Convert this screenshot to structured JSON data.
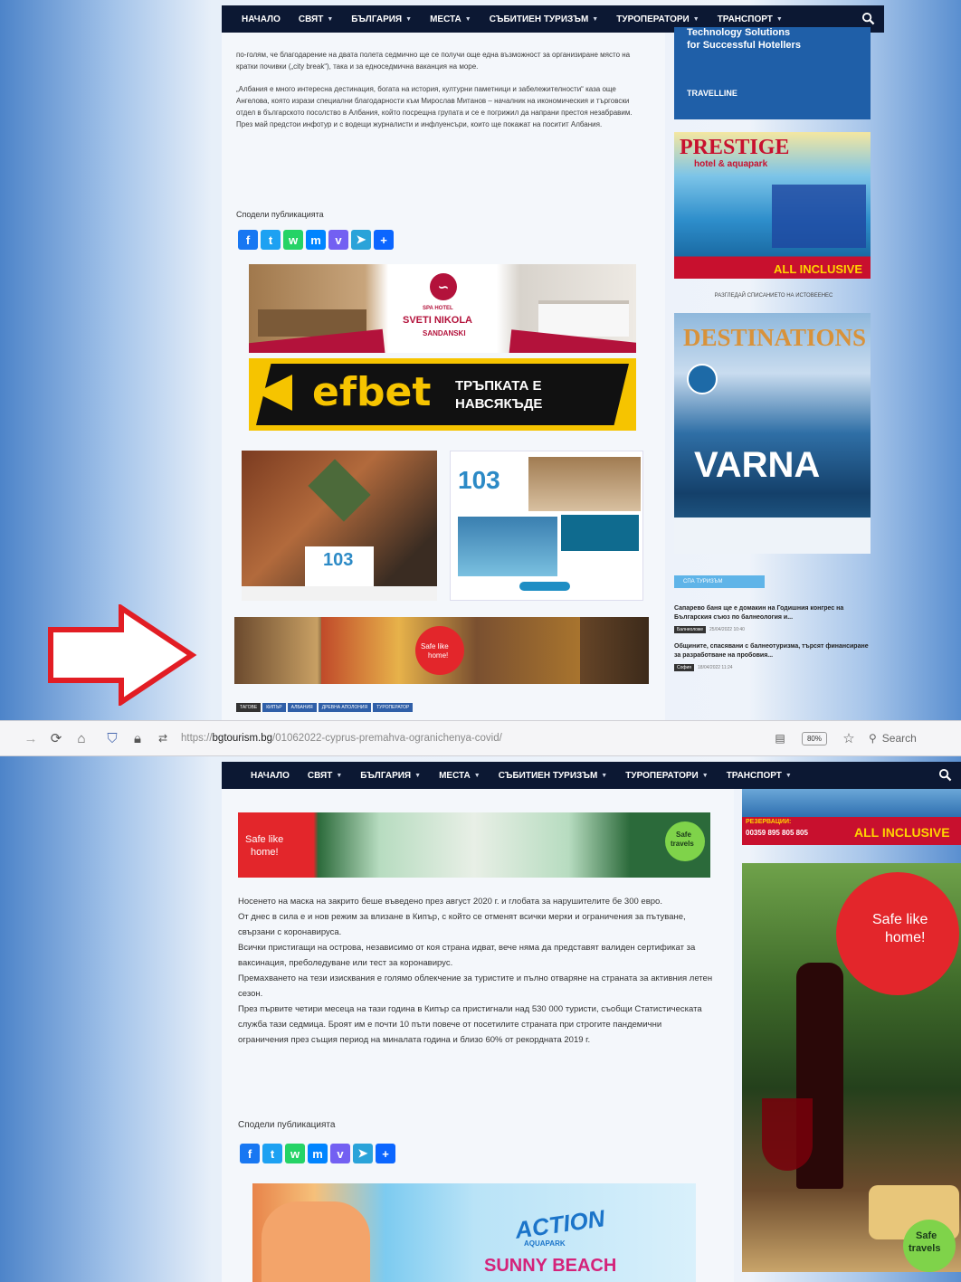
{
  "nav": {
    "items": [
      {
        "label": "НАЧАЛО",
        "dropdown": false
      },
      {
        "label": "СВЯТ",
        "dropdown": true
      },
      {
        "label": "БЪЛГАРИЯ",
        "dropdown": true
      },
      {
        "label": "МЕСТА",
        "dropdown": true
      },
      {
        "label": "СЪБИТИЕН ТУРИЗЪМ",
        "dropdown": true
      },
      {
        "label": "ТУРОПЕРАТОРИ",
        "dropdown": true
      },
      {
        "label": "ТРАНСПОРТ",
        "dropdown": true
      }
    ],
    "search_icon": "search-icon"
  },
  "top": {
    "paragraphs": [
      "по-голям, че благодарение на двата полета седмично ще се получи още една възможност за организиране място на кратки почивки („city break“), така и за едноседмична ваканция на море.",
      "„Албания е много интересна дестинация, богата на история, културни паметници и забележителности“ каза още Ангелова, която изрази специални благодарности към Мирослав Митанов – началник на икономическия и търговски отдел в българското посолство в Албания, който посрещна групата и се е погрижил да напрани престоя незабравим. През май предстои инфотур и с водещи журналисти и инфлуенсъри, които ще покажат на поситит Албания."
    ],
    "share_label": "Сподели публикацията",
    "ads": {
      "sveti_nikola": {
        "line1": "SPA HOTEL",
        "line2": "SVETI NIKOLA",
        "line3": "SANDANSKI"
      },
      "efbet": {
        "brand": "efbet",
        "slogan1": "ТРЪПКАТА Е",
        "slogan2": "НАВСЯКЪДЕ"
      },
      "hotel103_left": {
        "logo": "103"
      },
      "hotel103_right": {
        "logo": "103"
      },
      "safe_like_home": {
        "line1": "Safe like",
        "line2": "home!"
      }
    },
    "tags": [
      "ТАГОВЕ",
      "КИПЪР",
      "АЛБАНИЯ",
      "ДРЕВНА АПОЛОНИЯ",
      "ТУРОПЕРАТОР"
    ],
    "sidebar": {
      "travelline": {
        "line1": "Technology Solutions",
        "line2": "for Successful Hotellers",
        "brand": "TRAVELLINE"
      },
      "prestige": {
        "title": "PRESTIGE",
        "subtitle": "hotel & aquapark",
        "footer": "ALL INCLUSIVE"
      },
      "magazine_caption": "РАЗГЛЕДАЙ СПИСАНИЕТО НА ИСТОВЕЕНЕС",
      "destinations": {
        "title": "DESTINATIONS",
        "city": "VARNA"
      },
      "section_badge": "СПА ТУРИЗЪМ",
      "news": [
        {
          "title": "Сапарево баня ще е домакин на Годишния конгрес на Българския съюз по балнеология и...",
          "category": "Балнеоложе",
          "date": "25/04/2022 10:40"
        },
        {
          "title": "Общините, спасявани с балнеотуризма, търсят финансиране за разработване на пробовия...",
          "category": "София",
          "date": "18/04/2022 11:24"
        }
      ]
    }
  },
  "toolbar": {
    "url_prefix": "https://",
    "url_domain": "bgtourism.bg",
    "url_path": "/01062022-cyprus-premahva-ogranichenya-covid/",
    "zoom": "80%",
    "search_placeholder": "Search"
  },
  "bottom": {
    "paragraphs": [
      "Носенето на маска на закрито беше въведено през август 2020 г. и глобата за нарушителите бе 300 евро.",
      "От днес в сила е и нов режим за влизане в Кипър, с който се отменят всички мерки и ограничения за пътуване, свързани с коронавируса.",
      "Всички пристигащи на острова, независимо от коя страна идват, вече няма да представят валиден сертификат за ваксинация, преболедуване или тест за коронавирус.",
      "Премахването на тези изисквания е голямо облекчение за туристите и пълно отваряне на страната за активния летен сезон.",
      "През първите четири месеца на тази година в Кипър са пристигнали над 530 000 туристи, съобщи Статистическата служба тази седмица. Броят им е почти 10 пъти повече от посетилите страната при строгите пандемични ограничения през същия период на миналата година и близо 60% от рекордната 2019 г."
    ],
    "share_label": "Сподели публикацията",
    "ads": {
      "safe_banner": {
        "line1": "Safe like",
        "line2": "home!",
        "badge1": "Safe",
        "badge2": "travels"
      },
      "action_aquapark": {
        "brand": "ACTION",
        "sub": "AQUAPARK",
        "place": "SUNNY BEACH"
      },
      "sidebar_strip": {
        "reservations": "РЕЗЕРВАЦИИ:",
        "phone": "00359 895 805 805",
        "footer": "ALL INCLUSIVE"
      },
      "sidebar_tall": {
        "line1": "Safe like",
        "line2": "home!",
        "badge1": "Safe",
        "badge2": "travels"
      }
    }
  },
  "colors": {
    "nav_bg": "#0c1833",
    "arrow_red": "#e21d24",
    "efbet_yellow": "#f6c400",
    "prestige_red": "#c8102e"
  },
  "share_icons": [
    {
      "name": "facebook-icon",
      "glyph": "f",
      "color": "#1877f2"
    },
    {
      "name": "twitter-icon",
      "glyph": "t",
      "color": "#1da1f2"
    },
    {
      "name": "whatsapp-icon",
      "glyph": "w",
      "color": "#25d366"
    },
    {
      "name": "messenger-icon",
      "glyph": "m",
      "color": "#0084ff"
    },
    {
      "name": "viber-icon",
      "glyph": "v",
      "color": "#7360f2"
    },
    {
      "name": "telegram-icon",
      "glyph": "➤",
      "color": "#2aa3d9"
    },
    {
      "name": "add-more-icon",
      "glyph": "+",
      "color": "#0b66ff"
    }
  ]
}
